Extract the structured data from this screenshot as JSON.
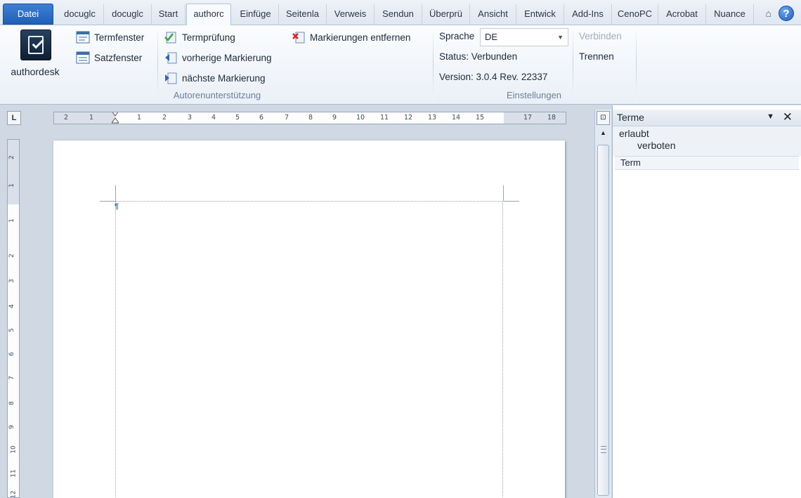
{
  "tabs": [
    {
      "label": "Datei",
      "kind": "file"
    },
    {
      "label": "docuglc"
    },
    {
      "label": "docuglc"
    },
    {
      "label": "Start"
    },
    {
      "label": "authorc",
      "active": true
    },
    {
      "label": "Einfüge"
    },
    {
      "label": "Seitenla"
    },
    {
      "label": "Verweis"
    },
    {
      "label": "Sendun"
    },
    {
      "label": "Überprü"
    },
    {
      "label": "Ansicht"
    },
    {
      "label": "Entwick"
    },
    {
      "label": "Add-Ins"
    },
    {
      "label": "CenoPC"
    },
    {
      "label": "Acrobat"
    },
    {
      "label": "Nuance"
    }
  ],
  "tab_icons": {
    "minimize_glyph": "⌂",
    "help_glyph": "?"
  },
  "ribbon": {
    "authordesk_label": "authordesk",
    "termfenster": "Termfenster",
    "satzfenster": "Satzfenster",
    "termpruefung": "Termprüfung",
    "vorherige": "vorherige Markierung",
    "naechste": "nächste Markierung",
    "markierungen_entfernen": "Markierungen entfernen",
    "group_autoren": "Autorenunterstützung",
    "sprache_label": "Sprache",
    "sprache_value": "DE",
    "status": "Status: Verbunden",
    "version": "Version: 3.0.4 Rev. 22337",
    "verbinden": "Verbinden",
    "trennen": "Trennen",
    "group_einstellungen": "Einstellungen"
  },
  "ruler": {
    "corner_glyph": "L",
    "h_labels": [
      "2",
      "1",
      "1",
      "2",
      "3",
      "4",
      "5",
      "6",
      "7",
      "8",
      "9",
      "10",
      "11",
      "12",
      "13",
      "14",
      "15",
      "17",
      "18"
    ],
    "v_labels": [
      "2",
      "1",
      "1",
      "2",
      "3",
      "4",
      "5",
      "6",
      "7",
      "8",
      "9",
      "10",
      "11",
      "12"
    ]
  },
  "document": {
    "cursor_glyph": "¶"
  },
  "pane": {
    "title": "Terme",
    "menu_glyph": "▼",
    "close_glyph": "✕",
    "legend_allowed": "erlaubt",
    "legend_forbidden": "verboten",
    "column_header": "Term"
  },
  "colors": {
    "file_tab": "#1f5fb7",
    "ribbon_bg": "#eaf0f7",
    "workspace_bg": "#cfd8e3"
  }
}
